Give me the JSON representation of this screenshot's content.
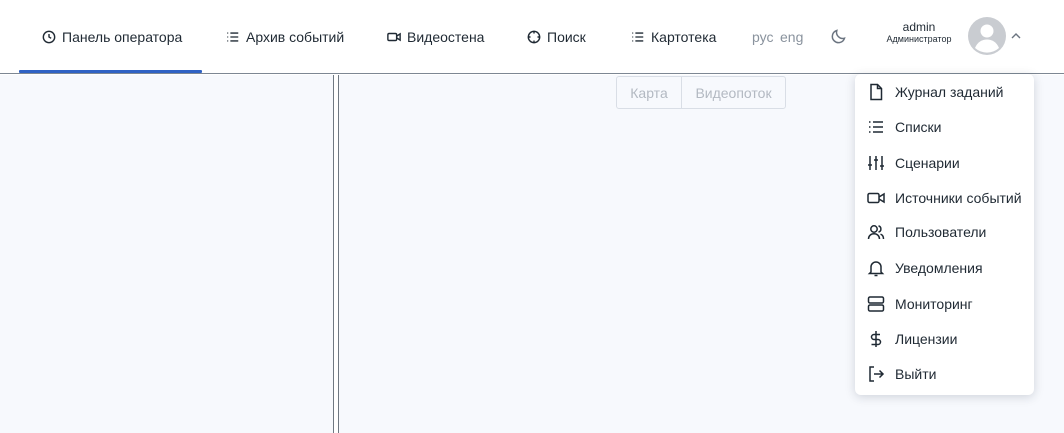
{
  "nav": {
    "items": [
      {
        "label": "Панель оператора",
        "icon": "clock-icon",
        "active": true
      },
      {
        "label": "Архив событий",
        "icon": "list-icon"
      },
      {
        "label": "Видеостена",
        "icon": "video-icon"
      },
      {
        "label": "Поиск",
        "icon": "crosshair-icon"
      },
      {
        "label": "Картотека",
        "icon": "list-icon"
      }
    ],
    "accent_color": "#2f62c4"
  },
  "language": {
    "options": [
      "рус",
      "eng"
    ]
  },
  "theme_toggle": {
    "icon": "moon-icon"
  },
  "user": {
    "name": "admin",
    "role": "Администратор",
    "avatar_icon": "user-avatar-icon",
    "menu_icon": "chevron-up-icon"
  },
  "view_toggle": {
    "options": [
      "Карта",
      "Видеопоток"
    ]
  },
  "user_menu": {
    "items": [
      {
        "label": "Журнал заданий",
        "icon": "file-icon"
      },
      {
        "label": "Списки",
        "icon": "list-icon"
      },
      {
        "label": "Сценарии",
        "icon": "sliders-icon"
      },
      {
        "label": "Источники событий",
        "icon": "video-icon"
      },
      {
        "label": "Пользователи",
        "icon": "users-icon"
      },
      {
        "label": "Уведомления",
        "icon": "bell-icon"
      },
      {
        "label": "Мониторинг",
        "icon": "server-icon"
      },
      {
        "label": "Лицензии",
        "icon": "dollar-icon"
      },
      {
        "label": "Выйти",
        "icon": "logout-icon"
      }
    ]
  }
}
